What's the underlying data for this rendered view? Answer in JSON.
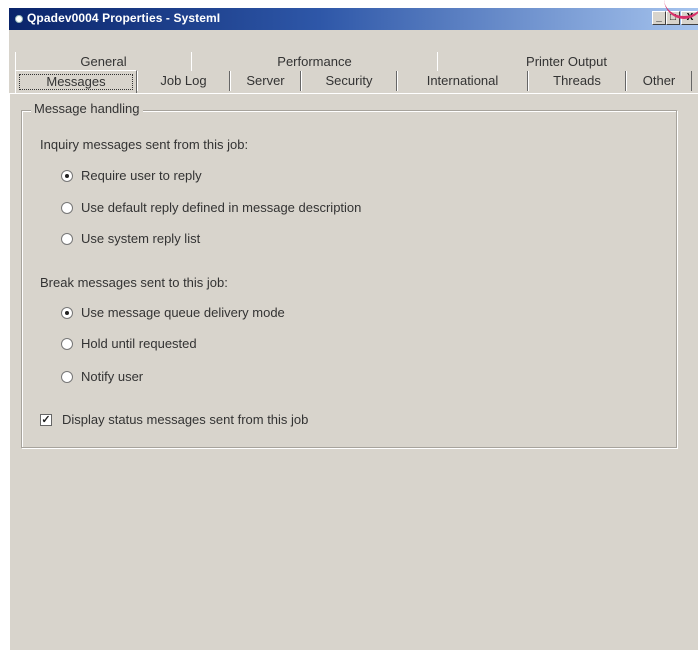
{
  "window": {
    "title": "Qpadev0004 Properties - SystemI",
    "minimize_glyph": "_",
    "maximize_glyph": "□",
    "close_glyph": "X"
  },
  "tabs": {
    "row1": [
      {
        "label": "General"
      },
      {
        "label": "Performance"
      },
      {
        "label": "Printer Output"
      }
    ],
    "row2": [
      {
        "label": "Messages",
        "active": true
      },
      {
        "label": "Job Log"
      },
      {
        "label": "Server"
      },
      {
        "label": "Security"
      },
      {
        "label": "International"
      },
      {
        "label": "Threads"
      },
      {
        "label": "Other"
      }
    ]
  },
  "message_handling": {
    "group_title": "Message handling",
    "inquiry": {
      "label": "Inquiry messages sent from this job:",
      "options": [
        {
          "label": "Require user to reply",
          "checked": true
        },
        {
          "label": "Use default reply defined in message description",
          "checked": false
        },
        {
          "label": "Use system reply list",
          "checked": false
        }
      ]
    },
    "break": {
      "label": "Break messages sent to this job:",
      "options": [
        {
          "label": "Use message queue delivery mode",
          "checked": true
        },
        {
          "label": "Hold until requested",
          "checked": false
        },
        {
          "label": "Notify user",
          "checked": false
        }
      ]
    },
    "display_status": {
      "label": "Display status messages sent from this job",
      "checked": true,
      "check_glyph": "✓"
    }
  }
}
